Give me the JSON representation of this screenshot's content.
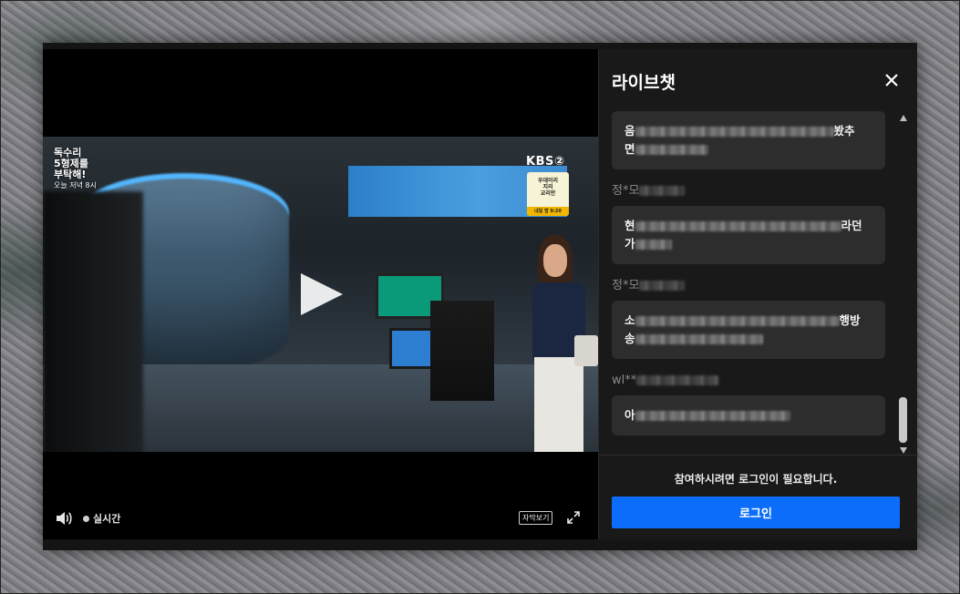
{
  "player": {
    "overlay_logo": {
      "line1": "독수리",
      "line2": "5형제를",
      "line3": "부탁해!",
      "schedule": "오늘 저녁 8시"
    },
    "channel_logo": "KBS②",
    "promo_badge": {
      "title_line1": "우데이리",
      "title_line2": "지리",
      "title_line3": "교리안",
      "bottom": "내일 밤 9:20"
    },
    "controls": {
      "live_label": "실시간",
      "subtitle_button": "자막보기"
    }
  },
  "chat": {
    "title": "라이브챗",
    "messages": [
      {
        "user": "",
        "text_start": "음",
        "text_end": "봤추",
        "line2_start": "면"
      },
      {
        "user": "정*모",
        "text_start": "현",
        "text_end": "라던",
        "line2_start": "가"
      },
      {
        "user": "정*모",
        "text_start": "소",
        "text_end": "행방",
        "line2_start": "송"
      },
      {
        "user": "wl**",
        "text_start": "아",
        "text_end": "",
        "line2_start": ""
      }
    ],
    "footer": {
      "login_required": "참여하시려면 로그인이 필요합니다.",
      "login_button": "로그인"
    }
  },
  "colors": {
    "accent": "#0c6dfa",
    "chat_bg": "#191919",
    "bubble_bg": "#2d2d2d"
  },
  "icons": {
    "volume": "speaker-icon",
    "fullscreen": "expand-icon",
    "close": "close-icon"
  }
}
